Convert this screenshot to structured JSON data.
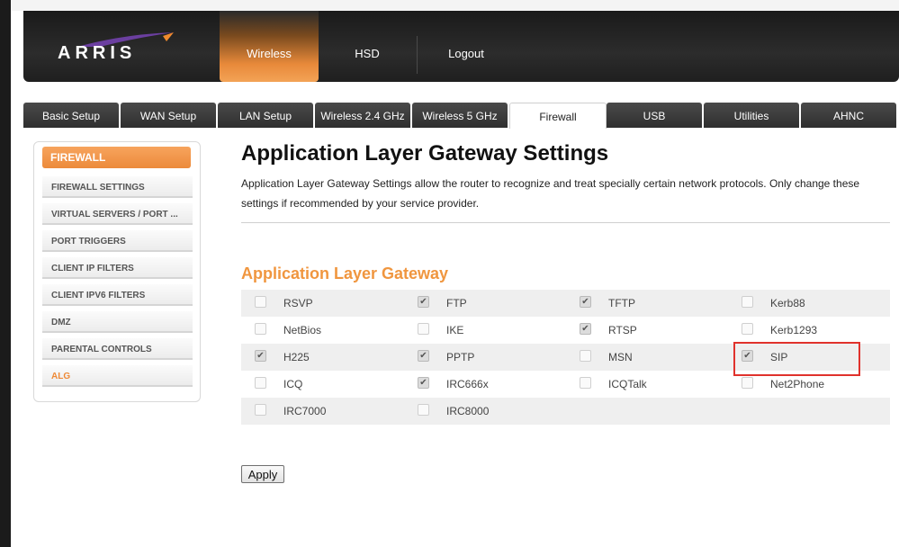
{
  "brand": {
    "logo_text": "ARRIS",
    "accent": "#ee8a37"
  },
  "topnav": {
    "items": [
      {
        "label": "Wireless",
        "active": true
      },
      {
        "label": "HSD",
        "active": false
      },
      {
        "label": "Logout",
        "active": false
      }
    ]
  },
  "tabs": [
    {
      "label": "Basic Setup",
      "active": false
    },
    {
      "label": "WAN Setup",
      "active": false
    },
    {
      "label": "LAN Setup",
      "active": false
    },
    {
      "label": "Wireless 2.4 GHz",
      "active": false
    },
    {
      "label": "Wireless 5 GHz",
      "active": false
    },
    {
      "label": "Firewall",
      "active": true
    },
    {
      "label": "USB",
      "active": false
    },
    {
      "label": "Utilities",
      "active": false
    },
    {
      "label": "AHNC",
      "active": false
    }
  ],
  "sidebar": {
    "heading": "FIREWALL",
    "items": [
      {
        "label": "FIREWALL SETTINGS",
        "active": false
      },
      {
        "label": "VIRTUAL SERVERS / PORT ...",
        "active": false
      },
      {
        "label": "PORT TRIGGERS",
        "active": false
      },
      {
        "label": "CLIENT IP FILTERS",
        "active": false
      },
      {
        "label": "CLIENT IPV6 FILTERS",
        "active": false
      },
      {
        "label": "DMZ",
        "active": false
      },
      {
        "label": "PARENTAL CONTROLS",
        "active": false
      },
      {
        "label": "ALG",
        "active": true
      }
    ]
  },
  "main": {
    "title": "Application Layer Gateway Settings",
    "description": "Application Layer Gateway Settings allow the router to recognize and treat specially certain network protocols. Only change these settings if recommended by your service provider.",
    "section_title": "Application Layer Gateway",
    "apply_label": "Apply",
    "protocols": [
      [
        {
          "label": "RSVP",
          "checked": false
        },
        {
          "label": "FTP",
          "checked": true
        },
        {
          "label": "TFTP",
          "checked": true
        },
        {
          "label": "Kerb88",
          "checked": false
        }
      ],
      [
        {
          "label": "NetBios",
          "checked": false
        },
        {
          "label": "IKE",
          "checked": false
        },
        {
          "label": "RTSP",
          "checked": true
        },
        {
          "label": "Kerb1293",
          "checked": false
        }
      ],
      [
        {
          "label": "H225",
          "checked": true
        },
        {
          "label": "PPTP",
          "checked": true
        },
        {
          "label": "MSN",
          "checked": false
        },
        {
          "label": "SIP",
          "checked": true
        }
      ],
      [
        {
          "label": "ICQ",
          "checked": false
        },
        {
          "label": "IRC666x",
          "checked": true
        },
        {
          "label": "ICQTalk",
          "checked": false
        },
        {
          "label": "Net2Phone",
          "checked": false
        }
      ],
      [
        {
          "label": "IRC7000",
          "checked": false
        },
        {
          "label": "IRC8000",
          "checked": false
        }
      ]
    ]
  }
}
